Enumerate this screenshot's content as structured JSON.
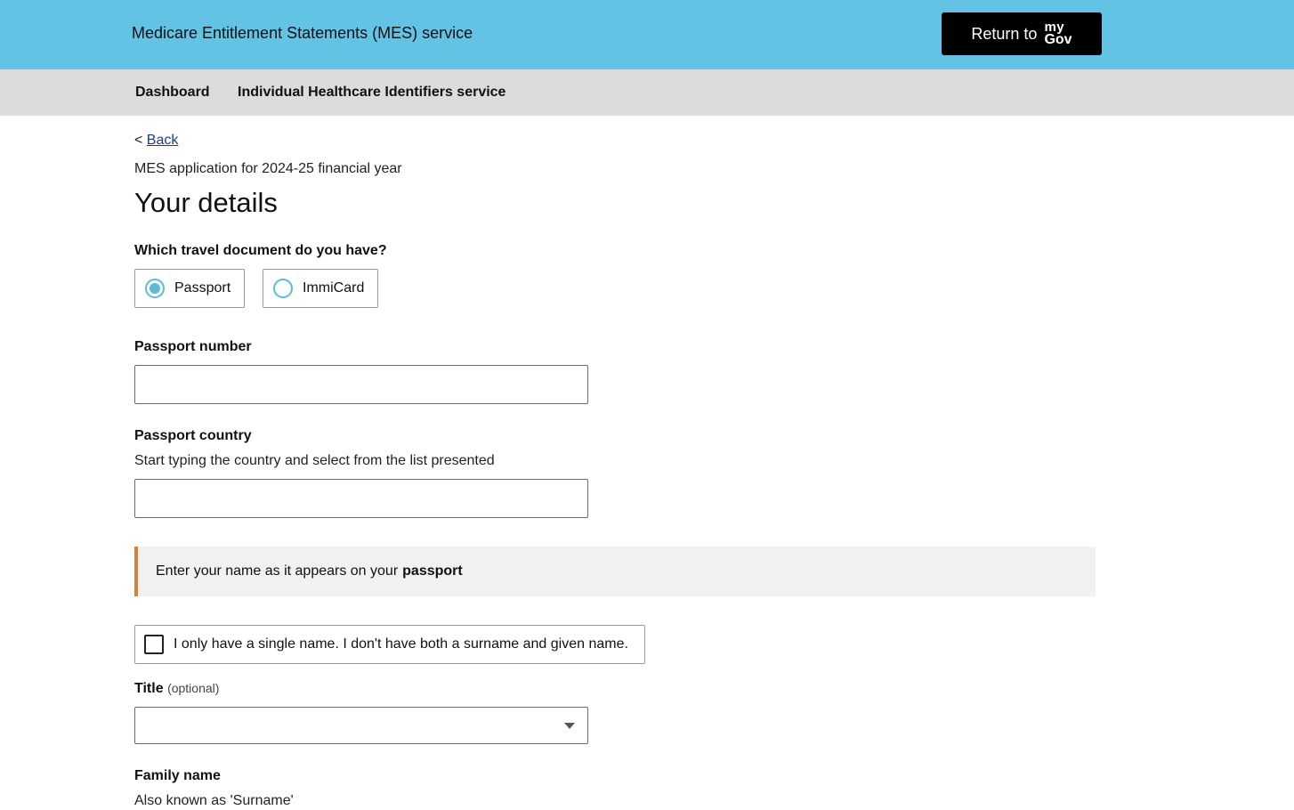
{
  "header": {
    "service_title": "Medicare Entitlement Statements (MES) service",
    "return_label": "Return to",
    "mygov_my": "my",
    "mygov_gov": "Gov"
  },
  "nav": {
    "items": [
      {
        "label": "Dashboard"
      },
      {
        "label": "Individual Healthcare Identifiers service"
      }
    ]
  },
  "back": {
    "prefix": "<",
    "label": "Back"
  },
  "subtitle": "MES application for 2024-25 financial year",
  "title": "Your details",
  "travel_document": {
    "question": "Which travel document do you have?",
    "options": [
      {
        "label": "Passport",
        "selected": true
      },
      {
        "label": "ImmiCard",
        "selected": false
      }
    ]
  },
  "passport_number": {
    "label": "Passport number",
    "value": ""
  },
  "passport_country": {
    "label": "Passport country",
    "hint": "Start typing the country and select from the list presented",
    "value": ""
  },
  "callout": {
    "text": "Enter your name as it appears on your",
    "emphasis": "passport"
  },
  "single_name": {
    "label": "I only have a single name. I don't have both a surname and given name.",
    "checked": false
  },
  "title_field": {
    "label": "Title",
    "optional": "(optional)",
    "value": ""
  },
  "family_name": {
    "label": "Family name",
    "hint": "Also known as 'Surname'"
  },
  "colors": {
    "header_bg": "#62c3e4",
    "nav_bg": "#dcdcdc",
    "radio_accent": "#5bbcd9",
    "callout_border": "#d3843c",
    "link": "#1d3c8c"
  }
}
